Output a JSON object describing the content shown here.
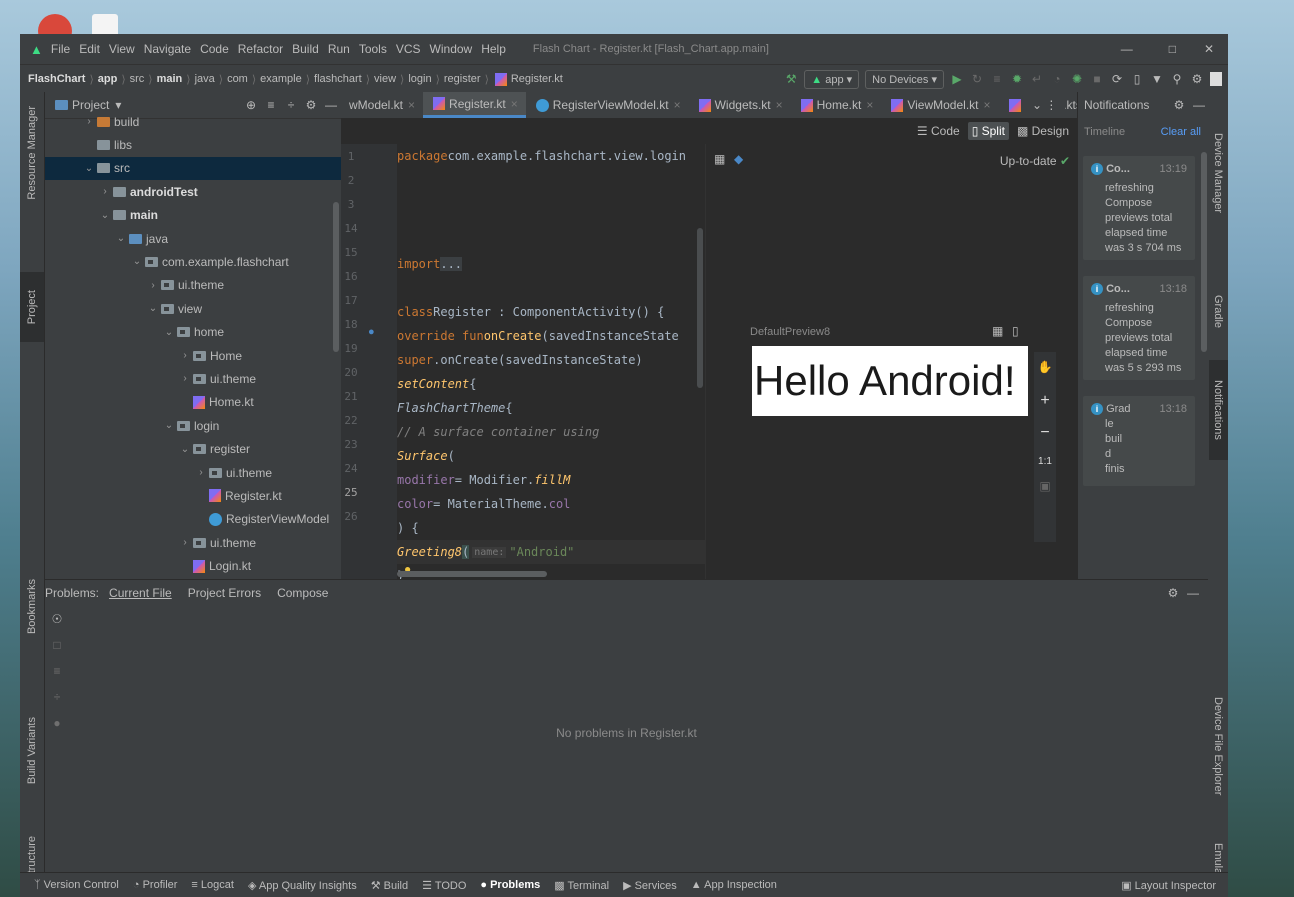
{
  "window": {
    "title": "Flash Chart - Register.kt [Flash_Chart.app.main]",
    "menu": [
      "File",
      "Edit",
      "View",
      "Navigate",
      "Code",
      "Refactor",
      "Build",
      "Run",
      "Tools",
      "VCS",
      "Window",
      "Help"
    ]
  },
  "breadcrumb": [
    "FlashChart",
    "app",
    "src",
    "main",
    "java",
    "com",
    "example",
    "flashchart",
    "view",
    "login",
    "register",
    "Register.kt"
  ],
  "run_config": {
    "module": "app",
    "device": "No Devices"
  },
  "project_panel": {
    "title": "Project",
    "tree": [
      {
        "label": "build",
        "depth": 1,
        "type": "folder-orange",
        "arrow": ">"
      },
      {
        "label": "libs",
        "depth": 1,
        "type": "folder",
        "arrow": ""
      },
      {
        "label": "src",
        "depth": 1,
        "type": "folder",
        "arrow": "v",
        "selected": true
      },
      {
        "label": "androidTest",
        "depth": 2,
        "type": "folder-test",
        "arrow": ">",
        "bold": true
      },
      {
        "label": "main",
        "depth": 2,
        "type": "folder-main",
        "arrow": "v",
        "bold": true
      },
      {
        "label": "java",
        "depth": 3,
        "type": "folder-blue",
        "arrow": "v"
      },
      {
        "label": "com.example.flashchart",
        "depth": 4,
        "type": "pkg",
        "arrow": "v"
      },
      {
        "label": "ui.theme",
        "depth": 5,
        "type": "pkg",
        "arrow": ">"
      },
      {
        "label": "view",
        "depth": 5,
        "type": "pkg",
        "arrow": "v"
      },
      {
        "label": "home",
        "depth": 6,
        "type": "pkg",
        "arrow": "v"
      },
      {
        "label": "Home",
        "depth": 7,
        "type": "pkg",
        "arrow": ">"
      },
      {
        "label": "ui.theme",
        "depth": 7,
        "type": "pkg",
        "arrow": ">"
      },
      {
        "label": "Home.kt",
        "depth": 7,
        "type": "kt",
        "arrow": ""
      },
      {
        "label": "login",
        "depth": 6,
        "type": "pkg",
        "arrow": "v"
      },
      {
        "label": "register",
        "depth": 7,
        "type": "pkg",
        "arrow": "v"
      },
      {
        "label": "ui.theme",
        "depth": 8,
        "type": "pkg",
        "arrow": ">"
      },
      {
        "label": "Register.kt",
        "depth": 8,
        "type": "kt",
        "arrow": ""
      },
      {
        "label": "RegisterViewModel",
        "depth": 8,
        "type": "vm",
        "arrow": ""
      },
      {
        "label": "ui.theme",
        "depth": 7,
        "type": "pkg",
        "arrow": ">"
      },
      {
        "label": "Login.kt",
        "depth": 7,
        "type": "kt",
        "arrow": ""
      }
    ]
  },
  "editor_tabs": [
    {
      "label": "wModel.kt",
      "type": "kt"
    },
    {
      "label": "Register.kt",
      "type": "kt",
      "active": true
    },
    {
      "label": "RegisterViewModel.kt",
      "type": "vm"
    },
    {
      "label": "Widgets.kt",
      "type": "kt"
    },
    {
      "label": "Home.kt",
      "type": "kt"
    },
    {
      "label": "ViewModel.kt",
      "type": "kt"
    },
    {
      "label": "scratch.kts",
      "type": "kt"
    }
  ],
  "view_modes": [
    "Code",
    "Split",
    "Design"
  ],
  "code": {
    "line_numbers": [
      "1",
      "2",
      "3",
      "14",
      "15",
      "16",
      "17",
      "18",
      "19",
      "20",
      "21",
      "22",
      "23",
      "24",
      "25",
      "26"
    ],
    "l1a": "package",
    "l1b": " com.example.flashchart.view.login",
    "l3a": "import",
    "l3b": " ...",
    "l15a": "class",
    "l15b": " Register : ComponentActivity() {",
    "l16a": "    override fun ",
    "l16b": "onCreate",
    "l16c": "(savedInstanceState",
    "l17a": "        super",
    "l17b": ".onCreate(savedInstanceState)",
    "l18a": "        setContent",
    "l18b": " {",
    "l19a": "            FlashChartTheme",
    "l19b": " {",
    "l20": "                // A surface container using",
    "l21a": "                Surface",
    "l21b": "(",
    "l22a": "                    modifier",
    "l22b": " = Modifier.",
    "l22c": "fillM",
    "l23a": "                    color",
    "l23b": " = MaterialTheme.",
    "l23c": "col",
    "l24": "                ) {",
    "l25a": "                    Greeting8",
    "l25b": "(",
    "l25c": "name:",
    "l25d": " \"Android\"",
    "l26": "                }"
  },
  "preview": {
    "status": "Up-to-date",
    "name": "DefaultPreview8",
    "text": "Hello Android!",
    "zoom": [
      "+",
      "−",
      "1:1"
    ]
  },
  "notifications": {
    "title": "Notifications",
    "timeline": "Timeline",
    "clear": "Clear all",
    "items": [
      {
        "title": "Co...",
        "time": "13:19",
        "lines": [
          "refreshing",
          "Compose",
          "previews total",
          "elapsed time",
          "was 3 s 704 ms"
        ]
      },
      {
        "title": "Co...",
        "time": "13:18",
        "lines": [
          "refreshing",
          "Compose",
          "previews total",
          "elapsed time",
          "was 5 s 293 ms"
        ]
      },
      {
        "title": "Grad",
        "time": "13:18",
        "lines": [
          "le",
          "buil",
          "d",
          "finis"
        ]
      }
    ]
  },
  "problems": {
    "label": "Problems:",
    "tabs": [
      "Current File",
      "Project Errors",
      "Compose"
    ],
    "empty": "No problems in Register.kt"
  },
  "left_tabs": [
    "Resource Manager",
    "Project",
    "Bookmarks",
    "Build Variants",
    "Structure"
  ],
  "right_tabs": [
    "Device Manager",
    "Gradle",
    "Notifications",
    "Device File Explorer",
    "Emulator"
  ],
  "bottom_tools": [
    "Version Control",
    "Profiler",
    "Logcat",
    "App Quality Insights",
    "Build",
    "TODO",
    "Problems",
    "Terminal",
    "Services",
    "App Inspection"
  ],
  "layout_inspector": "Layout Inspector"
}
